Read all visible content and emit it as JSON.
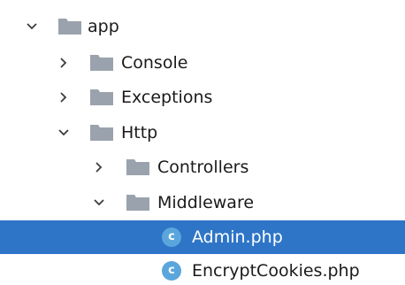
{
  "tree": {
    "items": [
      {
        "label": "app",
        "type": "folder",
        "expanded": true,
        "icon": "folder-icon"
      },
      {
        "label": "Console",
        "type": "folder",
        "expanded": false,
        "icon": "folder-icon"
      },
      {
        "label": "Exceptions",
        "type": "folder",
        "expanded": false,
        "icon": "folder-icon"
      },
      {
        "label": "Http",
        "type": "folder",
        "expanded": true,
        "icon": "folder-icon"
      },
      {
        "label": "Controllers",
        "type": "folder",
        "expanded": false,
        "icon": "folder-icon"
      },
      {
        "label": "Middleware",
        "type": "folder",
        "expanded": true,
        "icon": "folder-icon"
      },
      {
        "label": "Admin.php",
        "type": "class",
        "selected": true,
        "icon": "php-class-icon",
        "icon_letter": "c"
      },
      {
        "label": "EncryptCookies.php",
        "type": "class",
        "selected": false,
        "icon": "php-class-icon",
        "icon_letter": "c"
      }
    ]
  },
  "colors": {
    "selection": "#2e75c7",
    "folder": "#9aa3ad",
    "class_icon": "#5aa6dc",
    "chevron": "#3c3c3c"
  }
}
